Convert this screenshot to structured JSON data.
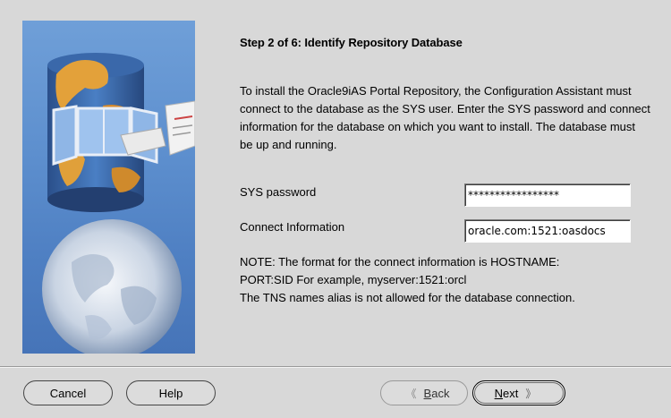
{
  "wizard": {
    "step_title": "Step 2 of 6: Identify Repository Database",
    "intro_text": "To install the Oracle9iAS Portal Repository, the Configuration Assistant must connect to the database as the SYS user. Enter the SYS password and connect information for the database on which you want to install. The database must be up and running."
  },
  "form": {
    "password_label": "SYS password",
    "password_value": "*****************",
    "connect_label": "Connect Information",
    "connect_value": "oracle.com:1521:oasdocs"
  },
  "note": {
    "line1": "NOTE: The format for the connect information is HOSTNAME:",
    "line2": "PORT:SID For example, myserver:1521:orcl",
    "line3": "The TNS names alias is not allowed for the database connection."
  },
  "buttons": {
    "cancel": "Cancel",
    "help": "Help",
    "back_first": "B",
    "back_rest": "ack",
    "next_first": "N",
    "next_rest": "ext",
    "back_arrow": "《",
    "next_arrow": "》"
  },
  "colors": {
    "background": "#d8d8d8",
    "panel_blue": "#5d8fce"
  }
}
